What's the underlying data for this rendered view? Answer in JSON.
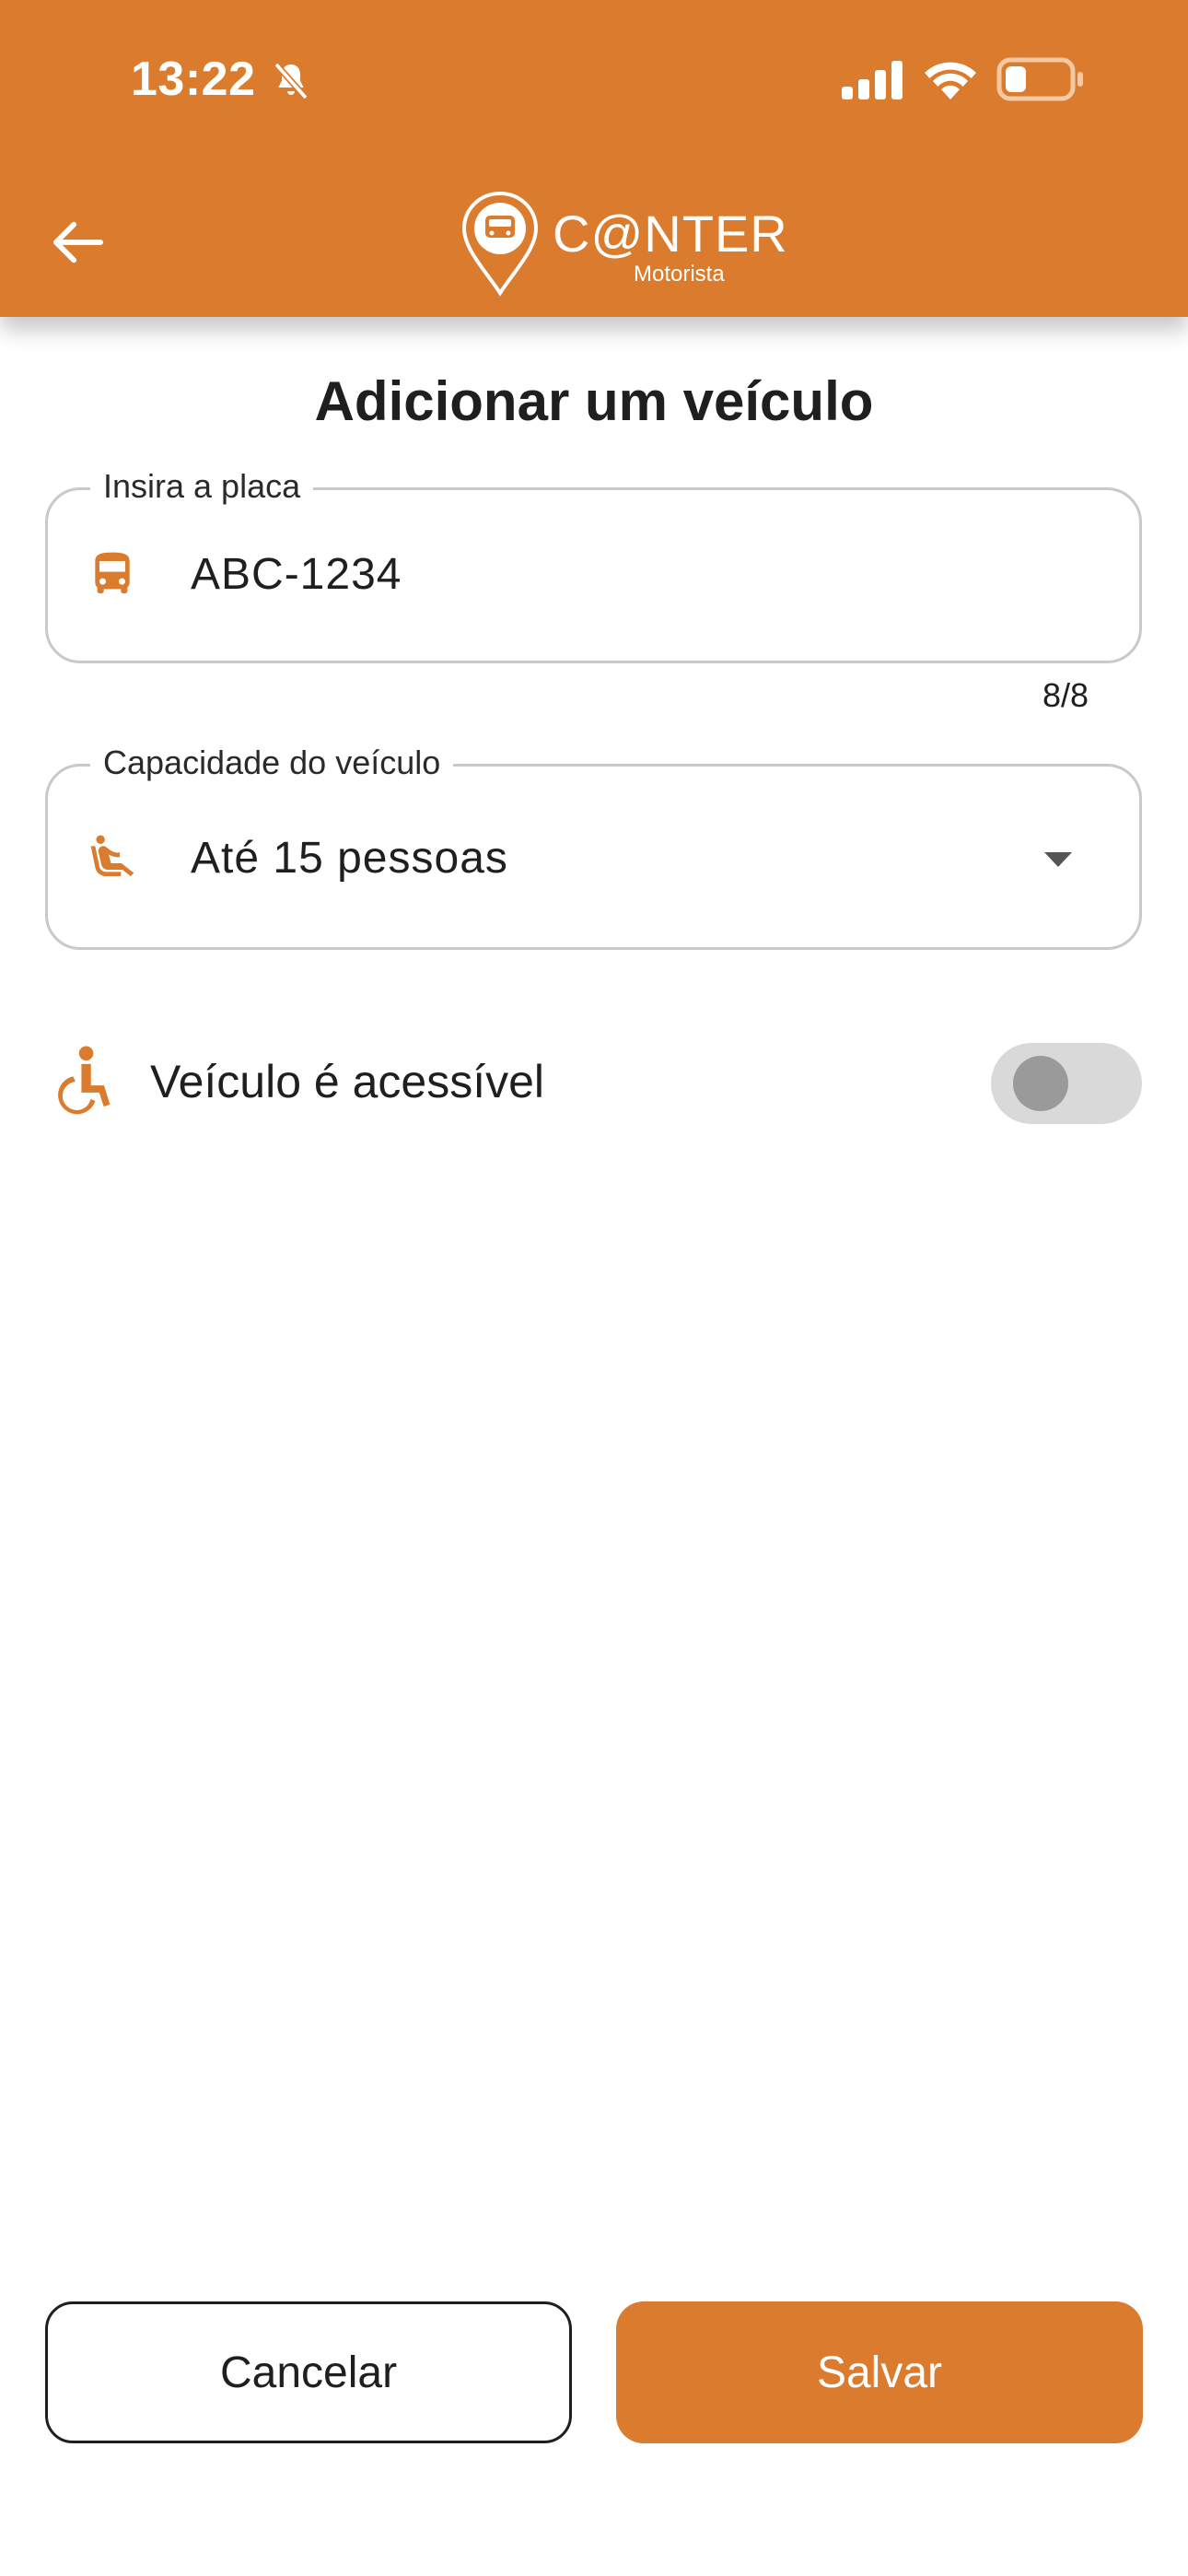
{
  "status_bar": {
    "time": "13:22",
    "icons": [
      "bell-slash-icon",
      "cellular-signal-icon",
      "wifi-icon",
      "battery-low-icon"
    ]
  },
  "header": {
    "back_icon": "arrow-left-icon",
    "logo_text": "C@NTER",
    "logo_subtitle": "Motorista",
    "logo_icon": "map-pin-bus-icon"
  },
  "page": {
    "title": "Adicionar um veículo"
  },
  "plate_field": {
    "label": "Insira a placa",
    "value": "ABC-1234",
    "icon": "bus-icon",
    "counter": "8/8"
  },
  "capacity_field": {
    "label": "Capacidade do veículo",
    "selected": "Até 15 pessoas",
    "icon": "seat-passenger-icon",
    "dropdown_icon": "caret-down-icon"
  },
  "accessibility": {
    "label": "Veículo é acessível",
    "icon": "wheelchair-icon",
    "enabled": false
  },
  "actions": {
    "cancel_label": "Cancelar",
    "save_label": "Salvar"
  },
  "colors": {
    "brand": "#DA7B2D",
    "toggle_track": "#D9D9D9",
    "toggle_knob": "#9A9A9A",
    "border": "#C9C9C9",
    "text": "#1F1F1F"
  }
}
